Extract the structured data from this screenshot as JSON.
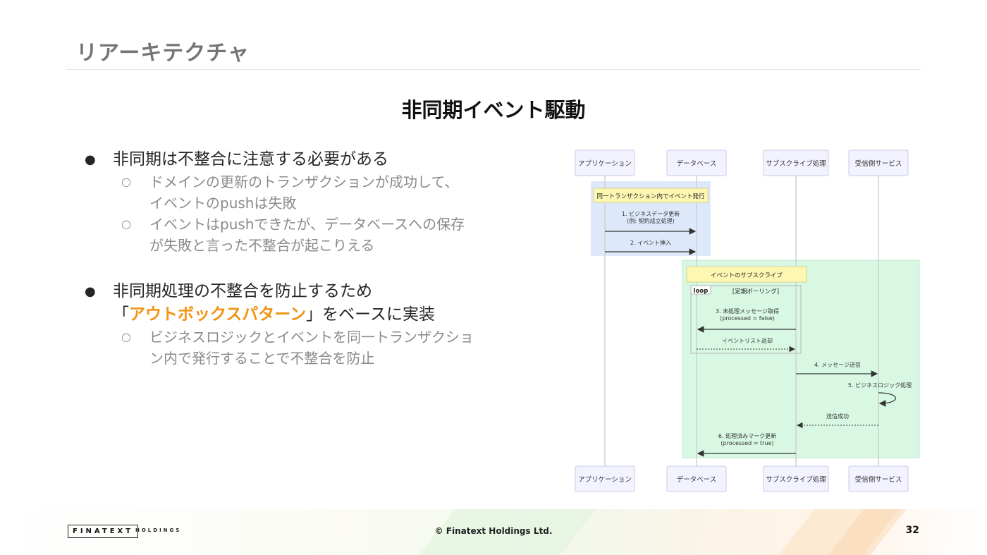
{
  "header": {
    "title": "リアーキテクチャ"
  },
  "section": {
    "heading": "非同期イベント駆動"
  },
  "bullets": {
    "b1": {
      "text": "非同期は不整合に注意する必要がある",
      "sub1_line1": "ドメインの更新のトランザクションが成功して、",
      "sub1_line2": "イベントのpushは失敗",
      "sub2_line1": "イベントはpushできたが、データベースへの保存",
      "sub2_line2": "が失敗と言った不整合が起こりえる"
    },
    "b2": {
      "line1": "非同期処理の不整合を防止するため",
      "line2_open": "「",
      "line2_accent": "アウトボックスパターン",
      "line2_rest": "」をベースに実装",
      "sub1_line1": "ビジネスロジックとイベントを同一トランザクショ",
      "sub1_line2": "ン内で発行することで不整合を防止"
    }
  },
  "diagram": {
    "participants": [
      "アプリケーション",
      "データベース",
      "サブスクライブ処理",
      "受信側サービス"
    ],
    "box1_note": "同一トランザクション内でイベント発行",
    "msg1_line1": "1. ビジネスデータ更新",
    "msg1_line2": "(例: 契約成立処理)",
    "msg2": "2. イベント挿入",
    "box2_note": "イベントのサブスクライブ",
    "loop_label": "loop",
    "loop_condition": "[定期ポーリング]",
    "msg3_line1": "3. 未処理メッセージ取得",
    "msg3_line2": "(processed = false)",
    "msg3_reply": "イベントリスト返却",
    "msg4": "4. メッセージ送信",
    "msg5": "5. ビジネスロジック処理",
    "msg5_reply": "送信成功",
    "msg6_line1": "6. 処理済みマーク更新",
    "msg6_line2": "(processed = true)",
    "colors": {
      "box1_fill": "#dde9fb",
      "box2_fill": "#d8f8e4",
      "note_fill": "#fdf7b2",
      "participant_fill": "#f3f3ff",
      "participant_border": "#c8c8ea"
    }
  },
  "footer": {
    "logo": "FINATEXT",
    "logo_sub": "HOLDINGS",
    "copyright": "© Finatext Holdings Ltd.",
    "page": "32"
  },
  "colors": {
    "accent": "#f29312",
    "title_gray": "#757575",
    "sub_gray": "#8a8a8a"
  }
}
